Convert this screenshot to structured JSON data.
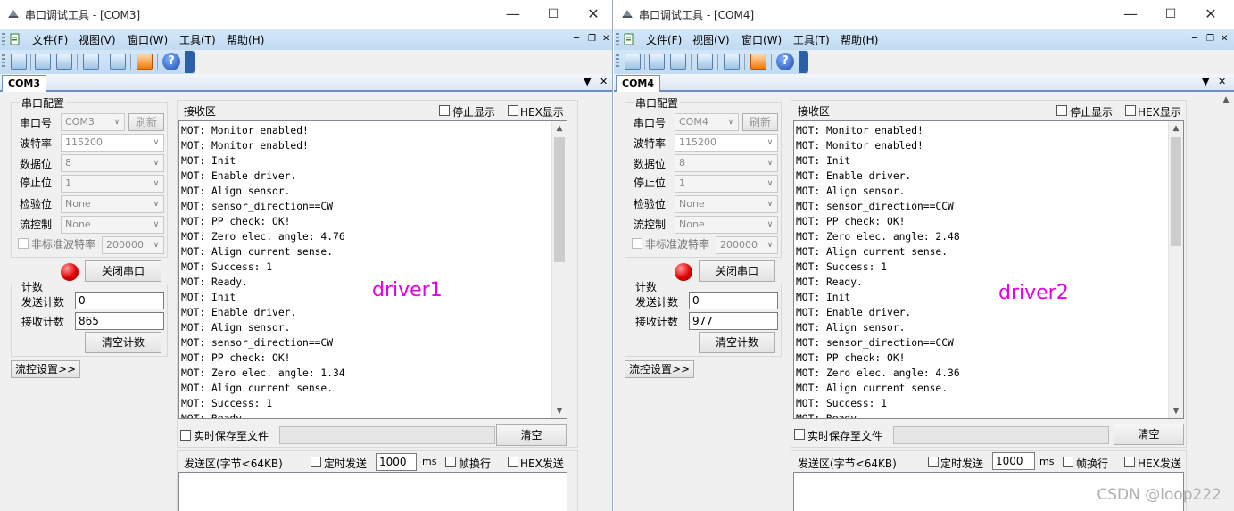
{
  "windows": [
    {
      "title": "串口调试工具 - [COM3]",
      "tab": "COM3",
      "menu": [
        "文件(F)",
        "视图(V)",
        "窗口(W)",
        "工具(T)",
        "帮助(H)"
      ],
      "serial_config": {
        "group_title": "串口配置",
        "port_label": "串口号",
        "port_value": "COM3",
        "refresh_label": "刷新",
        "baud_label": "波特率",
        "baud_value": "115200",
        "databits_label": "数据位",
        "databits_value": "8",
        "stopbits_label": "停止位",
        "stopbits_value": "1",
        "parity_label": "检验位",
        "parity_value": "None",
        "flow_label": "流控制",
        "flow_value": "None",
        "nonstd_label": "非标准波特率",
        "nonstd_value": "200000",
        "close_port_label": "关闭串口"
      },
      "counters": {
        "group_title": "计数",
        "sent_label": "发送计数",
        "sent_value": "0",
        "recv_label": "接收计数",
        "recv_value": "865",
        "clear_label": "清空计数"
      },
      "flow_settings_label": "流控设置>>",
      "receive": {
        "title": "接收区",
        "stop_display_label": "停止显示",
        "hex_display_label": "HEX显示",
        "lines": [
          "MOT: Monitor enabled!",
          "MOT: Monitor enabled!",
          "MOT: Init",
          "MOT: Enable driver.",
          "MOT: Align sensor.",
          "MOT: sensor_direction==CW",
          "MOT: PP check: OK!",
          "MOT: Zero elec. angle: 4.76",
          "MOT: Align current sense.",
          "MOT: Success: 1",
          "MOT: Ready.",
          "MOT: Init",
          "MOT: Enable driver.",
          "MOT: Align sensor.",
          "MOT: sensor_direction==CW",
          "MOT: PP check: OK!",
          "MOT: Zero elec. angle: 1.34",
          "MOT: Align current sense.",
          "MOT: Success: 1",
          "MOT: Ready."
        ],
        "overlay_text": "driver1",
        "save_label": "实时保存至文件",
        "clear_label": "清空"
      },
      "send": {
        "title": "发送区(字节<64KB)",
        "timed_label": "定时发送",
        "interval_value": "1000",
        "unit_label": "ms",
        "newline_label": "帧换行",
        "hex_send_label": "HEX发送"
      }
    },
    {
      "title": "串口调试工具 - [COM4]",
      "tab": "COM4",
      "menu": [
        "文件(F)",
        "视图(V)",
        "窗口(W)",
        "工具(T)",
        "帮助(H)"
      ],
      "serial_config": {
        "group_title": "串口配置",
        "port_label": "串口号",
        "port_value": "COM4",
        "refresh_label": "刷新",
        "baud_label": "波特率",
        "baud_value": "115200",
        "databits_label": "数据位",
        "databits_value": "8",
        "stopbits_label": "停止位",
        "stopbits_value": "1",
        "parity_label": "检验位",
        "parity_value": "None",
        "flow_label": "流控制",
        "flow_value": "None",
        "nonstd_label": "非标准波特率",
        "nonstd_value": "200000",
        "close_port_label": "关闭串口"
      },
      "counters": {
        "group_title": "计数",
        "sent_label": "发送计数",
        "sent_value": "0",
        "recv_label": "接收计数",
        "recv_value": "977",
        "clear_label": "清空计数"
      },
      "flow_settings_label": "流控设置>>",
      "receive": {
        "title": "接收区",
        "stop_display_label": "停止显示",
        "hex_display_label": "HEX显示",
        "lines": [
          "MOT: Monitor enabled!",
          "MOT: Monitor enabled!",
          "MOT: Init",
          "MOT: Enable driver.",
          "MOT: Align sensor.",
          "MOT: sensor_direction==CCW",
          "MOT: PP check: OK!",
          "MOT: Zero elec. angle: 2.48",
          "MOT: Align current sense.",
          "MOT: Success: 1",
          "MOT: Ready.",
          "MOT: Init",
          "MOT: Enable driver.",
          "MOT: Align sensor.",
          "MOT: sensor_direction==CCW",
          "MOT: PP check: OK!",
          "MOT: Zero elec. angle: 4.36",
          "MOT: Align current sense.",
          "MOT: Success: 1",
          "MOT: Ready."
        ],
        "overlay_text": "driver2",
        "save_label": "实时保存至文件",
        "clear_label": "清空"
      },
      "send": {
        "title": "发送区(字节<64KB)",
        "timed_label": "定时发送",
        "interval_value": "1000",
        "unit_label": "ms",
        "newline_label": "帧换行",
        "hex_send_label": "HEX发送"
      }
    }
  ],
  "watermark": "CSDN @loop222",
  "colors": {
    "overlay_text": "#e600e6",
    "led": "#e00000",
    "toolbar": "#c8e0f6"
  }
}
